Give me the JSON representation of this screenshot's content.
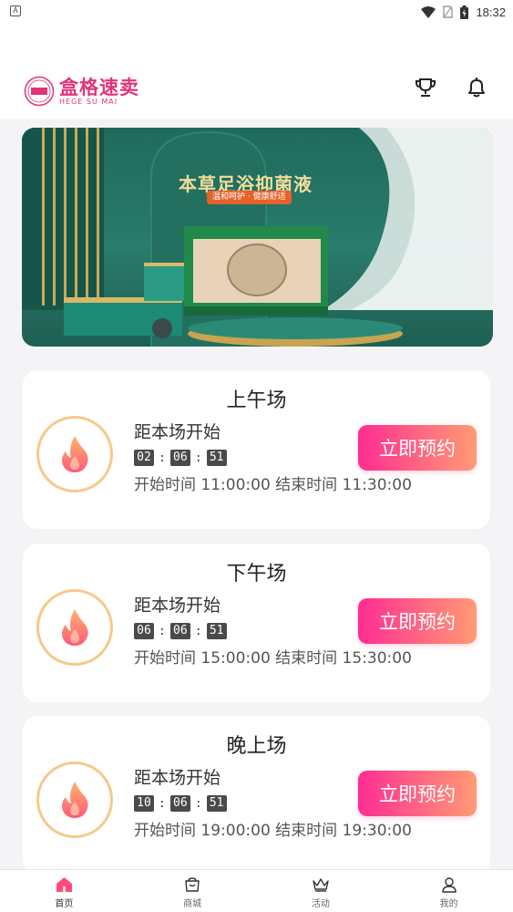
{
  "status_bar": {
    "left_icon_label": "A",
    "time": "18:32"
  },
  "header": {
    "logo_text": "盒格速卖",
    "logo_subtext": "HEGE SU MAI",
    "icons": [
      "trophy-icon",
      "bell-icon"
    ]
  },
  "banner": {
    "title": "本草足浴抑菌液",
    "subtitle": "温和呵护 · 健康舒适"
  },
  "sessions": [
    {
      "title": "上午场",
      "countdown_label": "距本场开始",
      "timer": [
        "02",
        "06",
        "51"
      ],
      "times": "开始时间 11:00:00 结束时间 11:30:00",
      "button_label": "立即预约"
    },
    {
      "title": "下午场",
      "countdown_label": "距本场开始",
      "timer": [
        "06",
        "06",
        "51"
      ],
      "times": "开始时间 15:00:00 结束时间 15:30:00",
      "button_label": "立即预约"
    },
    {
      "title": "晚上场",
      "countdown_label": "距本场开始",
      "timer": [
        "10",
        "06",
        "51"
      ],
      "times": "开始时间 19:00:00 结束时间 19:30:00",
      "button_label": "立即预约"
    }
  ],
  "tabbar": {
    "items": [
      {
        "label": "首页",
        "icon": "home-icon",
        "active": true
      },
      {
        "label": "商城",
        "icon": "shop-icon",
        "active": false
      },
      {
        "label": "活动",
        "icon": "crown-icon",
        "active": false
      },
      {
        "label": "我的",
        "icon": "user-icon",
        "active": false
      }
    ]
  },
  "colors": {
    "accent_pink": "#ff2d93",
    "accent_orange": "#ff9b74",
    "logo_pink": "#e2337a",
    "banner_green": "#2a7c6c"
  }
}
